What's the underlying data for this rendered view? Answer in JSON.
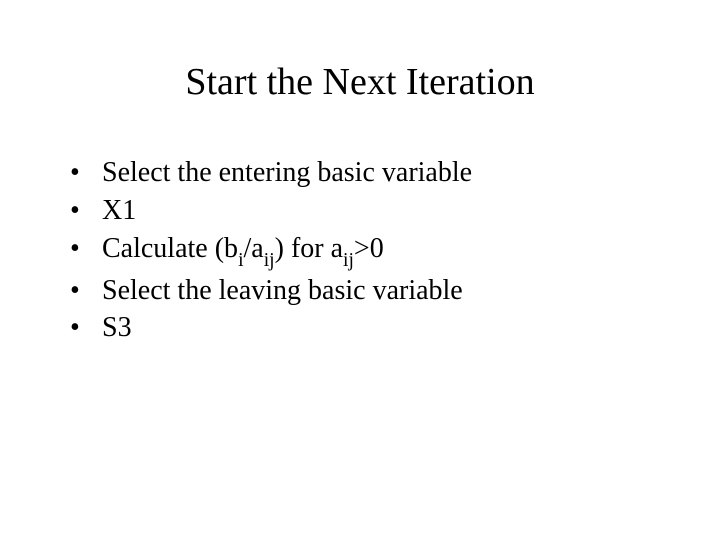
{
  "title": "Start the Next Iteration",
  "bullets": {
    "b0": "Select the entering basic variable",
    "b1": "X1",
    "b2": {
      "pre": "Calculate (b",
      "sub1": "i",
      "mid1": "/a",
      "sub2": "ij",
      "mid2": ") for a",
      "sub3": "ij",
      "post": ">0"
    },
    "b3": "Select the leaving basic variable",
    "b4": "S3"
  }
}
